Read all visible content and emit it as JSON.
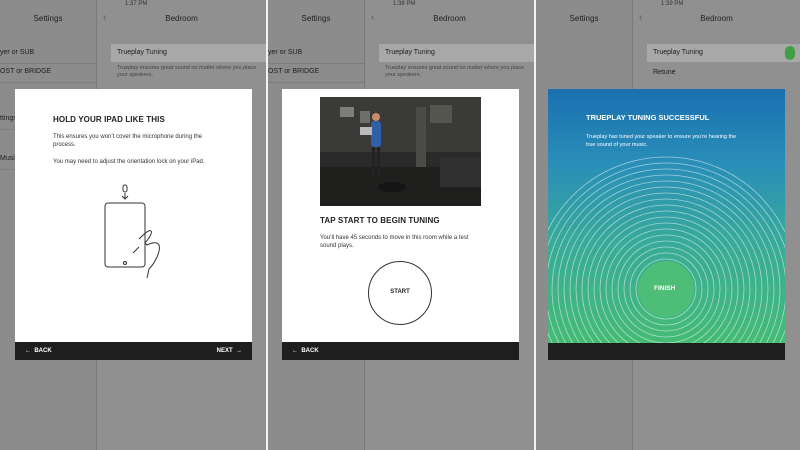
{
  "background": {
    "left_title": "Settings",
    "right_title": "Bedroom",
    "times": [
      "1:37 PM",
      "1:38 PM",
      "1:39 PM"
    ],
    "settings_items": [
      "yer or SUB",
      "OST or BRIDGE",
      "ettings",
      "ttings",
      "Musi",
      "ces",
      "me S",
      "d Set",
      "odate",
      "r So"
    ],
    "trueplay_label": "Trueplay Tuning",
    "trueplay_desc": "Trueplay ensures great sound no matter where you place your speakers.",
    "retune_label": "Retune"
  },
  "panel1": {
    "title": "HOLD YOUR IPAD LIKE THIS",
    "text1": "This ensures you won’t cover the microphone during the process.",
    "text2": "You may need to adjust the orientation lock on your iPad.",
    "back_label": "BACK",
    "next_label": "NEXT"
  },
  "panel2": {
    "title": "TAP START TO BEGIN TUNING",
    "text": "You’ll have 45 seconds to move in this room while a test sound plays.",
    "start_label": "START",
    "back_label": "BACK"
  },
  "panel3": {
    "title": "TRUEPLAY TUNING SUCCESSFUL",
    "text": "Trueplay has tuned your speaker to ensure you’re hearing the true sound of your music.",
    "finish_label": "FINISH"
  },
  "colors": {
    "accent_green": "#3f9e46",
    "gradient_top": "#1a6fb0",
    "gradient_bottom": "#45bb75",
    "footer": "#1e1e1e"
  },
  "icons": {
    "back": "arrow-left-icon",
    "next": "arrow-right-icon",
    "microphone": "microphone-icon",
    "ipad": "ipad-hand-icon"
  }
}
